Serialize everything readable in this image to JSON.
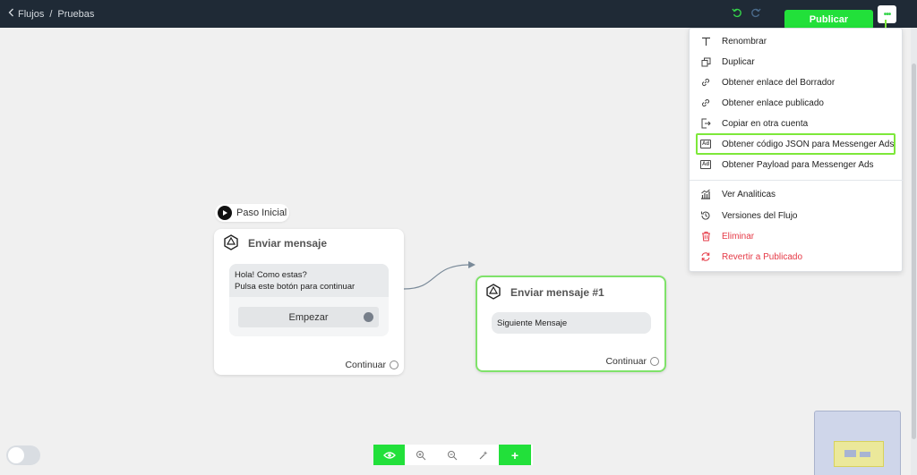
{
  "breadcrumb": {
    "back_icon": "chevron-left-icon",
    "parent": "Flujos",
    "separator": "/",
    "current": "Pruebas"
  },
  "header": {
    "undo_icon": "undo-icon",
    "redo_icon": "redo-icon",
    "publish_label": "Publicar",
    "more_icon": "more-horizontal-icon"
  },
  "canvas": {
    "start_label": "Paso Inicial",
    "node1": {
      "title": "Enviar mensaje",
      "message_line1": "Hola! Como estas?",
      "message_line2": "Pulsa este botón para continuar",
      "button_label": "Empezar",
      "continue_label": "Continuar"
    },
    "node2": {
      "title": "Enviar mensaje #1",
      "next_label": "Siguiente Mensaje",
      "continue_label": "Continuar"
    }
  },
  "menu": {
    "items": [
      {
        "label": "Renombrar",
        "icon": "text-icon"
      },
      {
        "label": "Duplicar",
        "icon": "copy-icon"
      },
      {
        "label": "Obtener enlace del Borrador",
        "icon": "link-icon"
      },
      {
        "label": "Obtener enlace publicado",
        "icon": "link-icon"
      },
      {
        "label": "Copiar en otra cuenta",
        "icon": "export-icon"
      },
      {
        "label": "Obtener código JSON para Messenger Ads",
        "icon": "ad-icon"
      },
      {
        "label": "Obtener Payload para Messenger Ads",
        "icon": "ad-icon"
      },
      {
        "label": "Ver Analiticas",
        "icon": "analytics-icon"
      },
      {
        "label": "Versiones del Flujo",
        "icon": "history-icon"
      },
      {
        "label": "Eliminar",
        "icon": "trash-icon"
      },
      {
        "label": "Revertir a Publicado",
        "icon": "revert-icon"
      }
    ]
  },
  "toolbar": {
    "preview_icon": "eye-icon",
    "zoom_in_icon": "zoom-in-icon",
    "zoom_out_icon": "zoom-out-icon",
    "auto_layout_icon": "magic-icon",
    "add_icon": "plus-icon"
  },
  "colors": {
    "accent": "#22e03a",
    "topbar": "#1f2a36",
    "danger": "#e53946",
    "highlight": "#7de83a"
  }
}
